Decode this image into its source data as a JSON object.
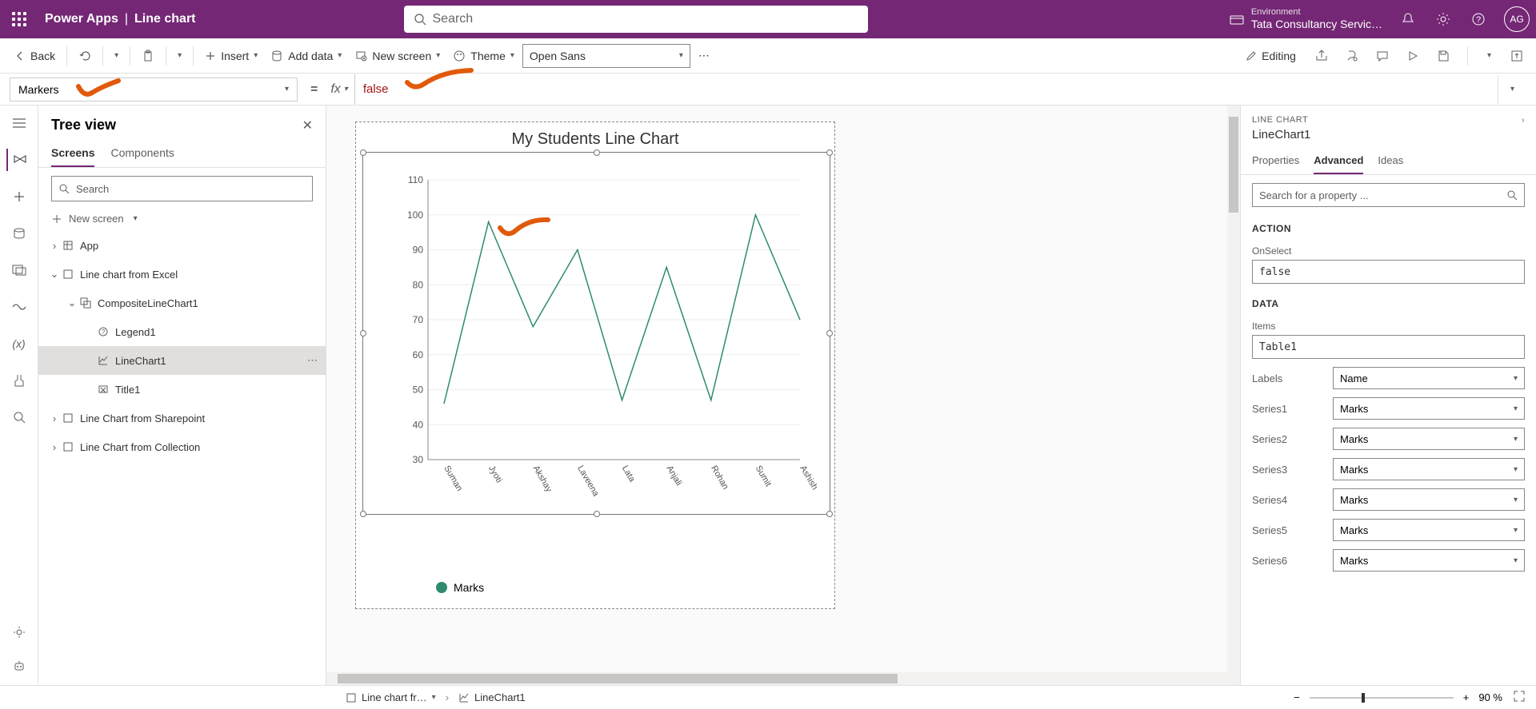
{
  "header": {
    "app": "Power Apps",
    "page": "Line chart",
    "search_placeholder": "Search",
    "env_label": "Environment",
    "env_value": "Tata Consultancy Servic…",
    "avatar": "AG"
  },
  "cmdbar": {
    "back": "Back",
    "insert": "Insert",
    "add_data": "Add data",
    "new_screen": "New screen",
    "theme": "Theme",
    "font": "Open Sans",
    "editing": "Editing"
  },
  "formula": {
    "property": "Markers",
    "fx": "fx",
    "value": "false"
  },
  "tree": {
    "title": "Tree view",
    "tabs": {
      "screens": "Screens",
      "components": "Components"
    },
    "search_placeholder": "Search",
    "new_screen": "New screen",
    "items": {
      "app": "App",
      "excel": "Line chart from Excel",
      "composite": "CompositeLineChart1",
      "legend": "Legend1",
      "linechart": "LineChart1",
      "title": "Title1",
      "sharepoint": "Line Chart from Sharepoint",
      "collection": "Line Chart from Collection"
    }
  },
  "props": {
    "type": "LINE CHART",
    "name": "LineChart1",
    "tabs": {
      "properties": "Properties",
      "advanced": "Advanced",
      "ideas": "Ideas"
    },
    "search_placeholder": "Search for a property ...",
    "section_action": "ACTION",
    "onselect_label": "OnSelect",
    "onselect_value": "false",
    "section_data": "DATA",
    "items_label": "Items",
    "items_value": "Table1",
    "rows": [
      {
        "label": "Labels",
        "value": "Name"
      },
      {
        "label": "Series1",
        "value": "Marks"
      },
      {
        "label": "Series2",
        "value": "Marks"
      },
      {
        "label": "Series3",
        "value": "Marks"
      },
      {
        "label": "Series4",
        "value": "Marks"
      },
      {
        "label": "Series5",
        "value": "Marks"
      },
      {
        "label": "Series6",
        "value": "Marks"
      }
    ]
  },
  "chart_data": {
    "type": "line",
    "title": "My Students Line Chart",
    "ylim": [
      30,
      110
    ],
    "yticks": [
      30,
      40,
      50,
      60,
      70,
      80,
      90,
      100,
      110
    ],
    "categories": [
      "Suman",
      "Jyoti",
      "Akshay",
      "Laveena",
      "Lata",
      "Anjali",
      "Rohan",
      "Sumit",
      "Ashish"
    ],
    "series": [
      {
        "name": "Marks",
        "values": [
          46,
          98,
          68,
          90,
          47,
          85,
          47,
          100,
          70
        ]
      }
    ],
    "legend": "Marks"
  },
  "status": {
    "crumb_screen": "Line chart fr…",
    "crumb_control": "LineChart1",
    "zoom": "90  %"
  }
}
